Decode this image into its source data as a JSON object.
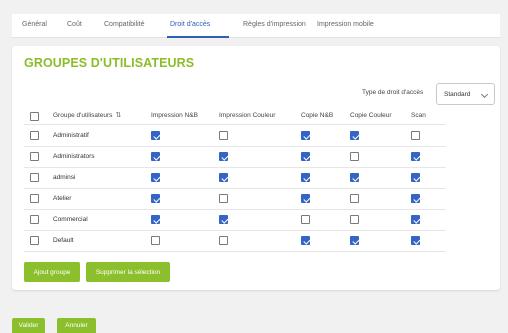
{
  "tabs": [
    "Général",
    "Coût",
    "Compatibilité",
    "Droit d'accès",
    "Règles d'impression",
    "Impression mobile"
  ],
  "active_tab": "Droit d'accès",
  "section_title": "GROUPES D'UTILISATEURS",
  "access_type": {
    "label": "Type de droit d'accès",
    "value": "Standard"
  },
  "table": {
    "headers": [
      "Groupe d'utilisateurs",
      "Impression N&B",
      "Impression Couleur",
      "Copie N&B",
      "Copie Couleur",
      "Scan"
    ],
    "sort_icon": "sort-arrows-icon",
    "rows": [
      {
        "name": "Administratif",
        "selected": false,
        "perms": [
          true,
          false,
          true,
          true,
          false
        ]
      },
      {
        "name": "Administrators",
        "selected": false,
        "perms": [
          true,
          true,
          true,
          false,
          true
        ]
      },
      {
        "name": "adminsi",
        "selected": false,
        "perms": [
          true,
          true,
          true,
          true,
          true
        ]
      },
      {
        "name": "Atelier",
        "selected": false,
        "perms": [
          true,
          false,
          true,
          false,
          true
        ]
      },
      {
        "name": "Commercial",
        "selected": false,
        "perms": [
          true,
          true,
          false,
          false,
          true
        ]
      },
      {
        "name": "Default",
        "selected": false,
        "perms": [
          false,
          false,
          true,
          true,
          true
        ]
      }
    ]
  },
  "buttons": {
    "add_group": "Ajout groupe",
    "delete_selection": "Supprimer la sélection"
  },
  "footer": {
    "validate": "Valider",
    "cancel": "Annuler"
  },
  "colors": {
    "accent_green": "#8cbf2c",
    "title_green": "#8bbd2a",
    "checkbox_blue": "#3464c4",
    "tab_active": "#2f5fb3"
  }
}
